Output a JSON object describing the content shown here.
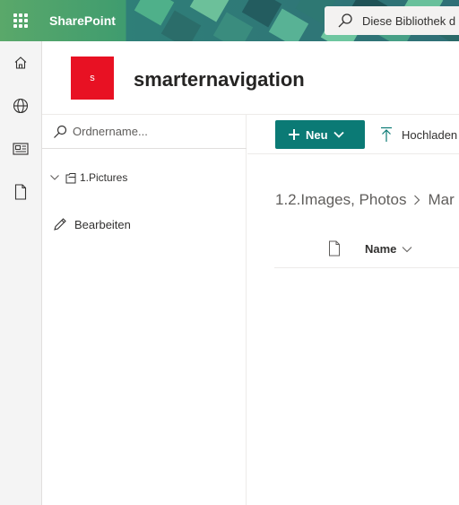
{
  "suite_bar": {
    "app_name": "SharePoint",
    "search_placeholder": "Diese Bibliothek d"
  },
  "app_bar": {
    "items": [
      {
        "icon": "home-icon"
      },
      {
        "icon": "globe-icon"
      },
      {
        "icon": "news-icon"
      },
      {
        "icon": "document-icon"
      }
    ]
  },
  "site": {
    "logo_letter": "s",
    "logo_color": "#e81123",
    "title": "smarternavigation"
  },
  "nav_pane": {
    "search_placeholder": "Ordnername...",
    "tree": [
      {
        "label": "1.Pictures",
        "expanded": true,
        "icon": "folder-tree-icon"
      }
    ],
    "edit_label": "Bearbeiten"
  },
  "command_bar": {
    "new_label": "Neu",
    "upload_label": "Hochladen",
    "accent": "#0b7a75"
  },
  "breadcrumb": {
    "items": [
      "1.2.Images, Photos",
      "Mar"
    ]
  },
  "list": {
    "columns": [
      {
        "label": "Name",
        "sortable": true
      }
    ]
  }
}
